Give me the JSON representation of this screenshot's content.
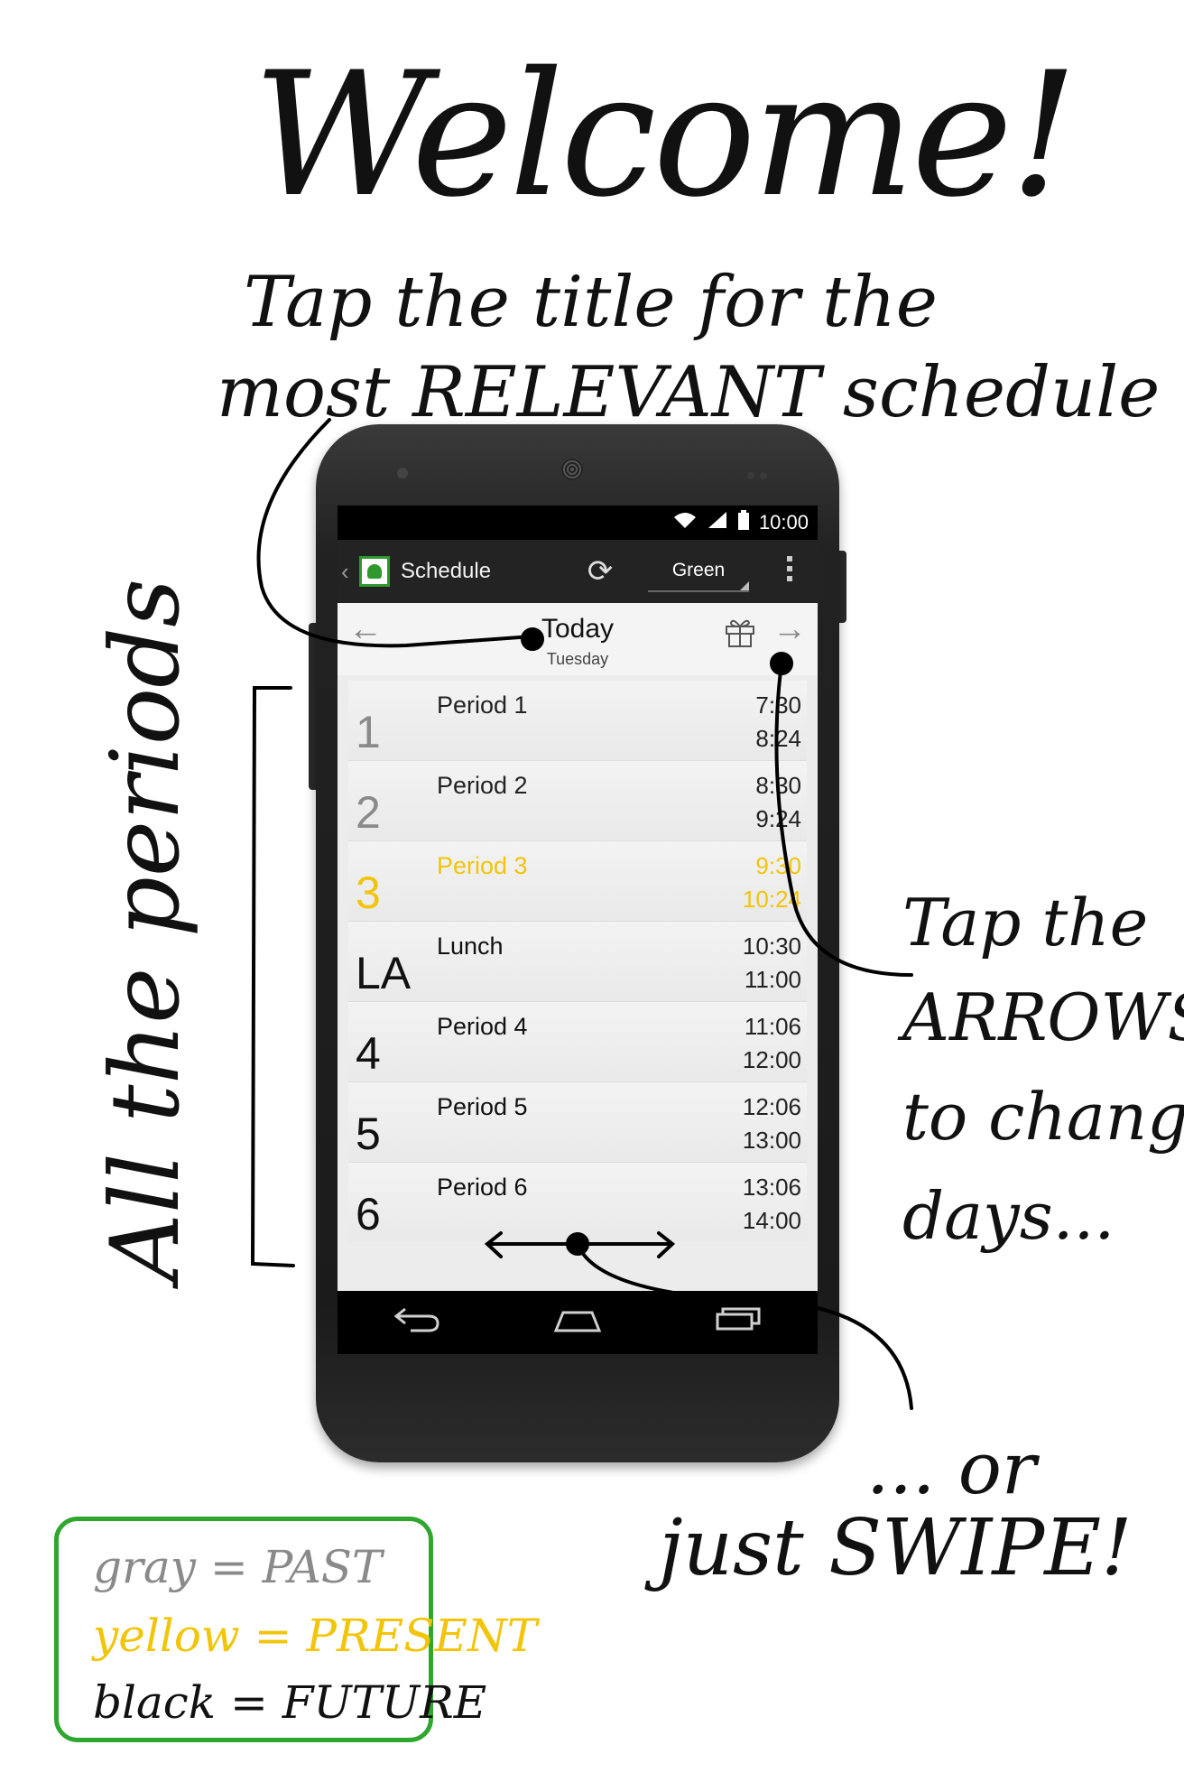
{
  "annotations": {
    "welcome": "Welcome!",
    "tap_title_line1": "Tap the title for the",
    "tap_title_line2": "most RELEVANT schedule",
    "periods_label": "All the periods",
    "arrows_line1": "Tap the",
    "arrows_line2": "ARROWS",
    "arrows_line3": "to change",
    "arrows_line4": "days...",
    "swipe_line1": "... or",
    "swipe_line2": "just SWIPE!"
  },
  "legend": {
    "gray": "gray = PAST",
    "yellow": "yellow = PRESENT",
    "black": "black = FUTURE",
    "colors": {
      "past": "#8a8a8a",
      "present": "#f2c40a",
      "future": "#111111",
      "border": "#2fa72f"
    }
  },
  "status_bar": {
    "time": "10:00"
  },
  "action_bar": {
    "title": "Schedule",
    "schedule_selector": "Green",
    "icons": [
      "up-caret-icon",
      "app-logo",
      "refresh-icon",
      "overflow-menu-icon"
    ]
  },
  "day_header": {
    "title": "Today",
    "subtitle": "Tuesday"
  },
  "periods": [
    {
      "num": "1",
      "name": "Period 1",
      "start": "7:30",
      "end": "8:24",
      "state": "past"
    },
    {
      "num": "2",
      "name": "Period 2",
      "start": "8:30",
      "end": "9:24",
      "state": "past"
    },
    {
      "num": "3",
      "name": "Period 3",
      "start": "9:30",
      "end": "10:24",
      "state": "present"
    },
    {
      "num": "LA",
      "name": "Lunch",
      "start": "10:30",
      "end": "11:00",
      "state": "future"
    },
    {
      "num": "4",
      "name": "Period 4",
      "start": "11:06",
      "end": "12:00",
      "state": "future"
    },
    {
      "num": "5",
      "name": "Period 5",
      "start": "12:06",
      "end": "13:00",
      "state": "future"
    },
    {
      "num": "6",
      "name": "Period 6",
      "start": "13:06",
      "end": "14:00",
      "state": "future"
    }
  ],
  "nav_bar": {
    "icons": [
      "back-icon",
      "home-icon",
      "recents-icon"
    ]
  }
}
